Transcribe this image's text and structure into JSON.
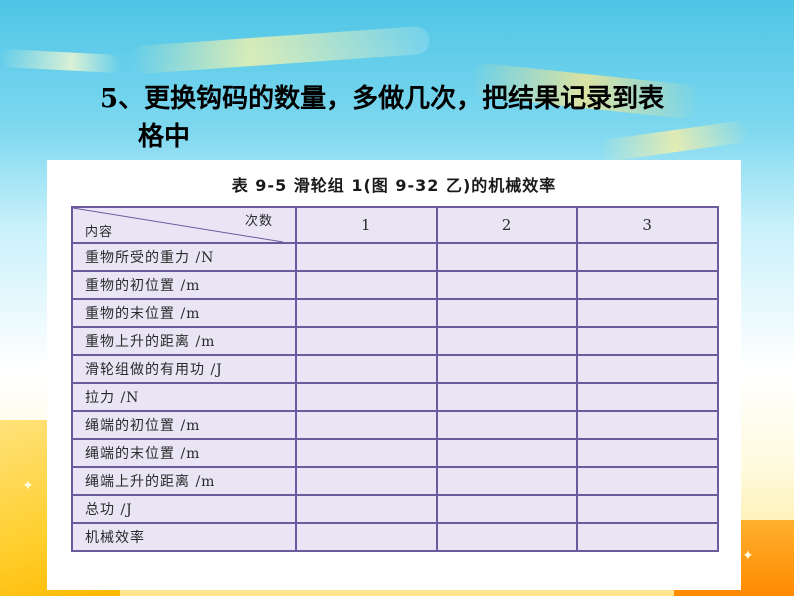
{
  "heading": {
    "line1": "5、更换钩码的数量，多做几次，把结果记录到表",
    "line2": "格中"
  },
  "table": {
    "caption": "表 9-5   滑轮组 1(图 9-32 乙)的机械效率",
    "header_top_right": "次数",
    "header_bottom_left": "内容",
    "columns": [
      "1",
      "2",
      "3"
    ],
    "rows": [
      "重物所受的重力 /N",
      "重物的初位置 /m",
      "重物的末位置 /m",
      "重物上升的距离 /m",
      "滑轮组做的有用功 /J",
      "拉力 /N",
      "绳端的初位置 /m",
      "绳端的末位置 /m",
      "绳端上升的距离 /m",
      "总功 /J",
      "机械效率"
    ]
  },
  "colors": {
    "table_border": "#6b5a9c",
    "table_fill": "#e9e5f5"
  }
}
